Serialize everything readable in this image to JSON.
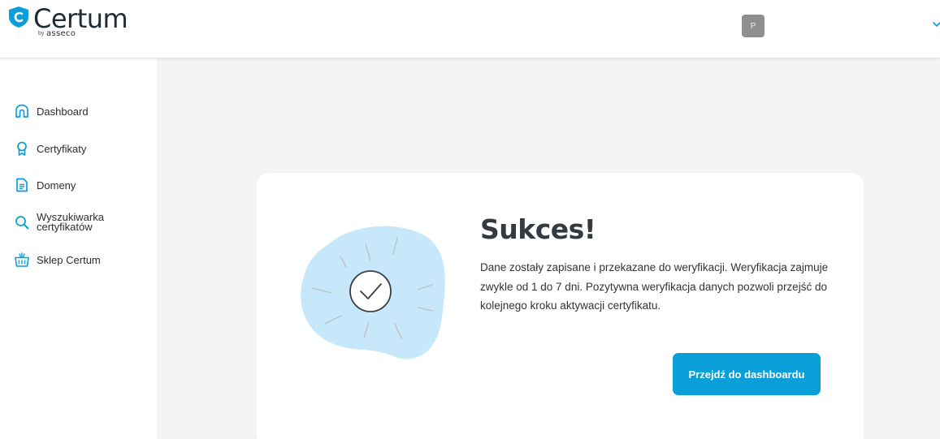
{
  "header": {
    "brand": "Certum",
    "brand_by": "by",
    "brand_parent": "asseco",
    "avatar_initial": "P"
  },
  "sidebar": {
    "items": [
      {
        "label": "Dashboard",
        "icon": "home-icon"
      },
      {
        "label": "Certyfikaty",
        "icon": "award-icon"
      },
      {
        "label": "Domeny",
        "icon": "document-icon"
      },
      {
        "label": "Wyszukiwarka certyfikatów",
        "icon": "search-icon"
      },
      {
        "label": "Sklep Certum",
        "icon": "basket-icon"
      }
    ]
  },
  "card": {
    "title": "Sukces!",
    "description": "Dane zostały zapisane i przekazane do weryfikacji. Weryfikacja zajmuje zwykle od 1 do 7 dni. Pozytywna weryfikacja danych pozwoli przejść do kolejnego kroku aktywacji certyfikatu.",
    "button_label": "Przejdź do dashboardu"
  },
  "colors": {
    "accent": "#0a9fd8",
    "blob": "#c7e8fb",
    "background": "#f4f4f4"
  }
}
